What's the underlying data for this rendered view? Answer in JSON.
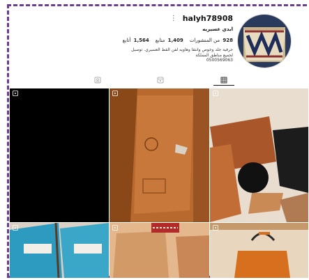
{
  "profile": {
    "username": "halyh78908",
    "display_name": "ابدي عسيريه",
    "stats": {
      "posts_count": "928",
      "posts_label": "من المنشورات",
      "followers_count": "1,409",
      "followers_label": "متابع",
      "following_count": "1,564",
      "following_label": "أتابع"
    },
    "bio_lines": [
      "حرفية جلد وخوص وانتقا وهاويه لفن القط العسيري. توصيل",
      "لجميع مناطق المملكة",
      "0500569063"
    ]
  },
  "tabs": [
    {
      "icon": "tagged-icon"
    },
    {
      "icon": "reels-icon"
    },
    {
      "icon": "grid-icon",
      "active": true
    }
  ],
  "grid": [
    {
      "description": "reel",
      "badge": "reel-icon"
    },
    {
      "description": "reel",
      "badge": "reel-icon"
    },
    {
      "description": "reel",
      "badge": "reel-icon"
    },
    {
      "description": "reel",
      "badge": "reel-icon"
    },
    {
      "description": "reel",
      "badge": "reel-icon"
    },
    {
      "description": "reel",
      "badge": "reel-icon"
    }
  ],
  "colors": {
    "frame": "#6a3d8f",
    "leather": "#b8652a",
    "black": "#000000"
  }
}
